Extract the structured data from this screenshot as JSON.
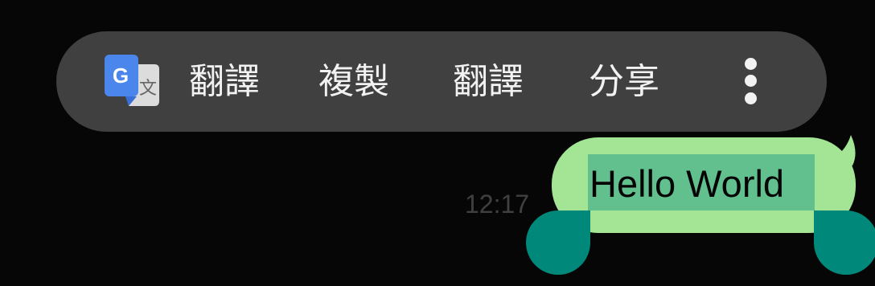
{
  "toolbar": {
    "icon": "google-translate-icon",
    "items": [
      {
        "label": "翻譯"
      },
      {
        "label": "複製"
      },
      {
        "label": "翻譯"
      },
      {
        "label": "分享"
      }
    ],
    "more_icon": "more-vertical-icon"
  },
  "message": {
    "time": "12:17",
    "text": "Hello World",
    "bubble_color": "#a3e595",
    "selection_color": "#61c08e",
    "handle_color": "#00897b"
  },
  "colors": {
    "background": "#060606",
    "toolbar": "#404040",
    "toolbar_text": "#f2f2f2"
  }
}
